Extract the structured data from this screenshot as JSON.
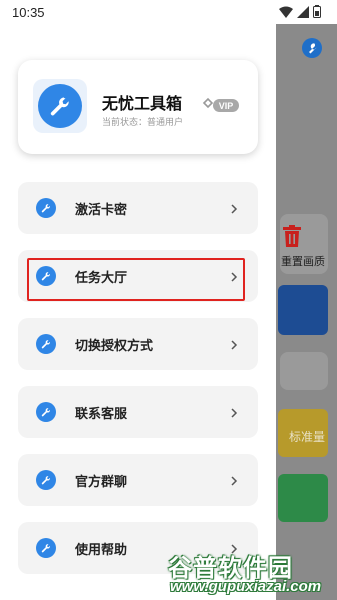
{
  "status_bar": {
    "time": "10:35"
  },
  "profile": {
    "title": "无忧工具箱",
    "status": "当前状态：普通用户",
    "badge": "VIP"
  },
  "menu": [
    {
      "label": "激活卡密",
      "icon": "wrench-icon"
    },
    {
      "label": "任务大厅",
      "icon": "wrench-icon",
      "highlighted": true
    },
    {
      "label": "切换授权方式",
      "icon": "wrench-icon"
    },
    {
      "label": "联系客服",
      "icon": "wrench-icon"
    },
    {
      "label": "官方群聊",
      "icon": "wrench-icon"
    },
    {
      "label": "使用帮助",
      "icon": "wrench-icon"
    }
  ],
  "background": {
    "trash_label": "重置画质",
    "yellow_label": "标准量"
  },
  "watermark": {
    "name": "谷普软件园",
    "url": "www.gupuxiazai.com"
  },
  "colors": {
    "accent": "#2f86e6",
    "highlight": "#e0231f"
  }
}
